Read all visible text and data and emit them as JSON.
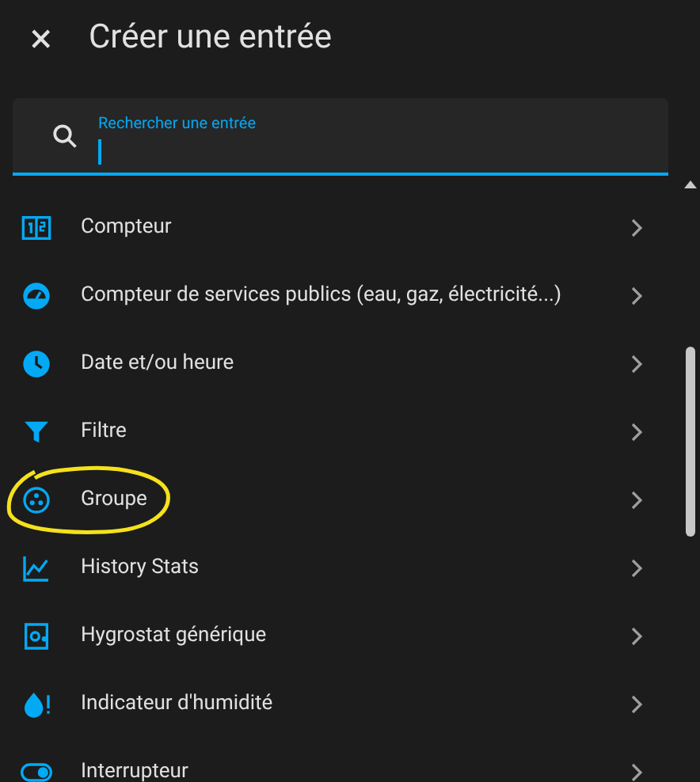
{
  "dialog": {
    "title": "Créer une entrée",
    "close_icon": "×"
  },
  "search": {
    "placeholder": "Rechercher une entrée"
  },
  "items": [
    {
      "label": "Compteur",
      "circled": false
    },
    {
      "label": "Compteur de services publics (eau, gaz, électricité...)",
      "circled": false
    },
    {
      "label": "Date et/ou heure",
      "circled": false
    },
    {
      "label": "Filtre",
      "circled": false
    },
    {
      "label": "Groupe",
      "circled": true
    },
    {
      "label": "History Stats",
      "circled": false
    },
    {
      "label": "Hygrostat générique",
      "circled": false
    },
    {
      "label": "Indicateur d'humidité",
      "circled": false
    },
    {
      "label": "Interrupteur",
      "circled": false
    }
  ]
}
